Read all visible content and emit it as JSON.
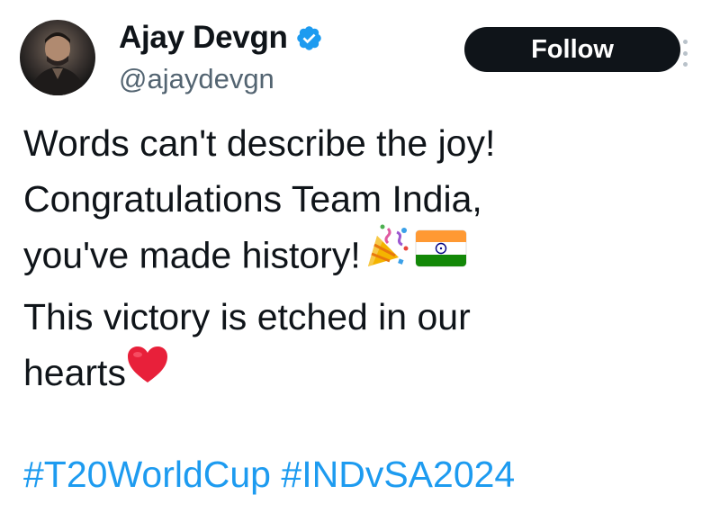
{
  "author": {
    "display_name": "Ajay Devgn",
    "handle": "@ajaydevgn",
    "verified": true
  },
  "actions": {
    "follow_label": "Follow"
  },
  "tweet": {
    "lines": [
      "Words can't describe the joy!",
      "Congratulations Team India,",
      "you've made history!",
      "This victory is etched in our",
      "hearts"
    ],
    "emojis": {
      "line3": [
        "party-popper",
        "india-flag"
      ],
      "line5": [
        "red-heart"
      ]
    },
    "hashtags": [
      "#T20WorldCup",
      "#INDvSA2024"
    ]
  },
  "colors": {
    "text": "#0f1419",
    "secondary": "#536471",
    "link": "#1d9bf0",
    "button_bg": "#0f1419",
    "verified": "#1d9bf0"
  }
}
